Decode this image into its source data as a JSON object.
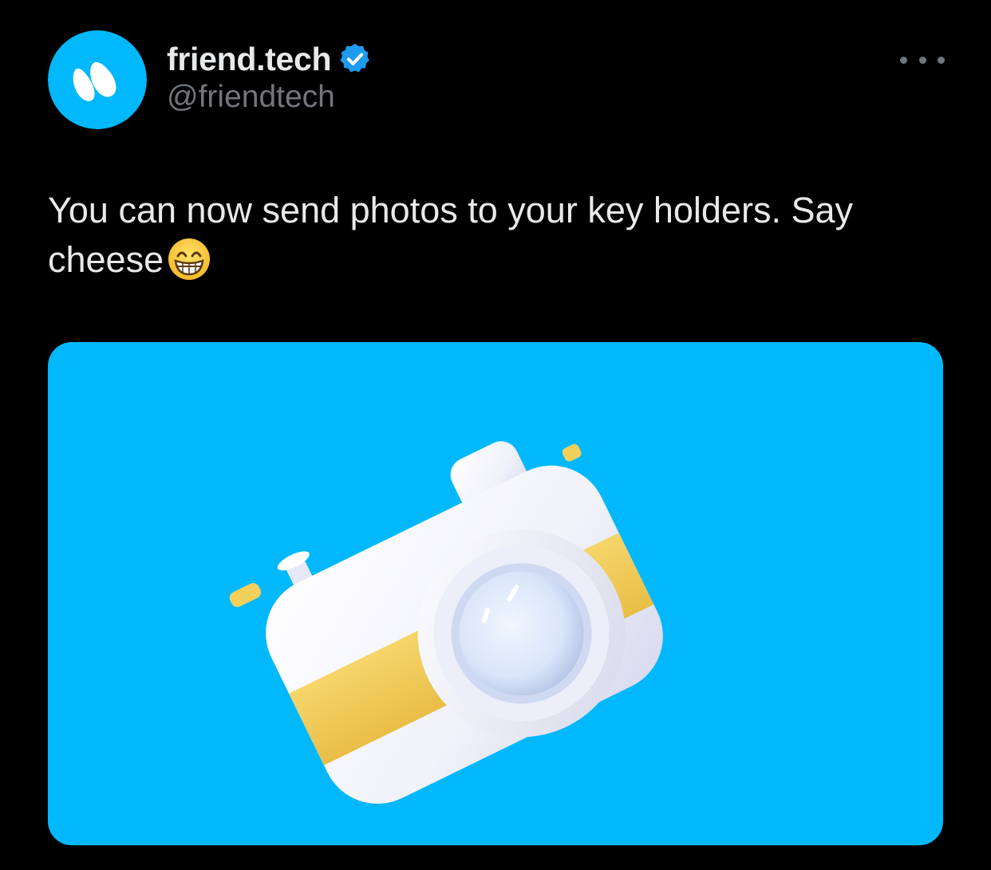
{
  "tweet": {
    "author": {
      "display_name": "friend.tech",
      "handle": "@friendtech",
      "verified": true,
      "avatar_icon": "friendtech-logo-icon"
    },
    "more_icon": "more-options-icon",
    "text_main": "You can now send photos to your key holders. Say cheese",
    "text_emoji": "grinning-face-with-smiling-eyes-emoji",
    "media": {
      "type": "image",
      "description_icon": "camera-3d-icon"
    }
  },
  "colors": {
    "background": "#000000",
    "text_primary": "#e7e9ea",
    "text_secondary": "#71767b",
    "verified_blue": "#1d9bf0",
    "brand_blue": "#00b8fb",
    "camera_yellow": "#f2cf5b"
  }
}
